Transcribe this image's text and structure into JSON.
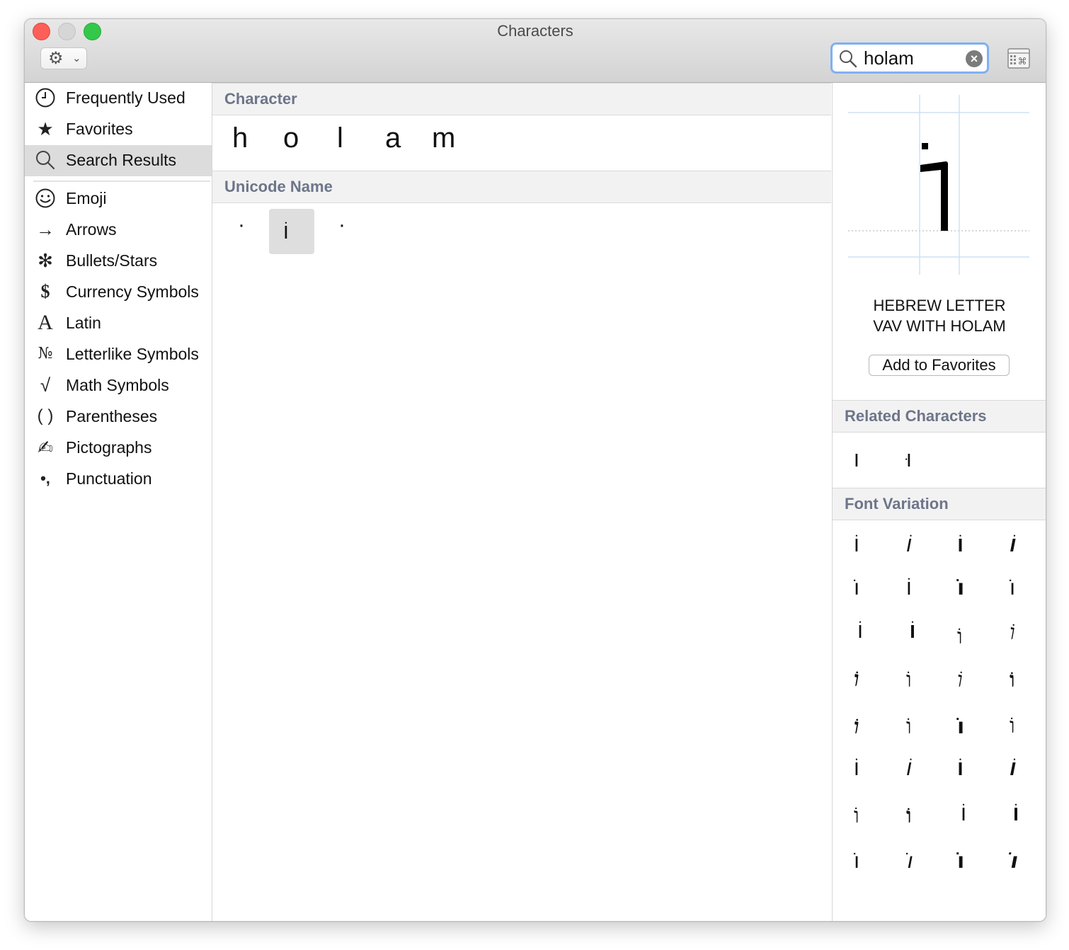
{
  "window": {
    "title": "Characters"
  },
  "search": {
    "value": "holam"
  },
  "sidebar": {
    "items": [
      {
        "label": "Frequently Used",
        "icon": "clock-icon",
        "glyph": "◷"
      },
      {
        "label": "Favorites",
        "icon": "star-icon",
        "glyph": "★"
      },
      {
        "label": "Search Results",
        "icon": "magnifier-icon",
        "glyph": "⌕"
      },
      {
        "label": "Emoji",
        "icon": "smiley-icon",
        "glyph": "☺"
      },
      {
        "label": "Arrows",
        "icon": "arrow-icon",
        "glyph": "→"
      },
      {
        "label": "Bullets/Stars",
        "icon": "asterisk-icon",
        "glyph": "✻"
      },
      {
        "label": "Currency Symbols",
        "icon": "dollar-icon",
        "glyph": "$"
      },
      {
        "label": "Latin",
        "icon": "latin-a-icon",
        "glyph": "A"
      },
      {
        "label": "Letterlike Symbols",
        "icon": "numero-icon",
        "glyph": "№"
      },
      {
        "label": "Math Symbols",
        "icon": "sqrt-icon",
        "glyph": "√"
      },
      {
        "label": "Parentheses",
        "icon": "parentheses-icon",
        "glyph": "( )"
      },
      {
        "label": "Pictographs",
        "icon": "writing-hand-icon",
        "glyph": "✍"
      },
      {
        "label": "Punctuation",
        "icon": "punctuation-icon",
        "glyph": "•,"
      }
    ],
    "selected_index": 2
  },
  "main": {
    "character_header": "Character",
    "letters": [
      "h",
      "o",
      "l",
      "a",
      "m"
    ],
    "unicode_header": "Unicode Name",
    "results": [
      "·",
      "וֹ",
      "·"
    ]
  },
  "detail": {
    "glyph": "וֹ",
    "name_line1": "HEBREW LETTER",
    "name_line2": "VAV WITH HOLAM",
    "add_favorites": "Add to Favorites",
    "related_header": "Related Characters",
    "related": [
      "ו",
      "וּ"
    ],
    "font_variation_header": "Font Variation",
    "variations": [
      "וֹ",
      "וֹ",
      "וֹ",
      "וֹ",
      "וֹ",
      "וֹ",
      "וֹ",
      "וֹ",
      "וֹ",
      "וֹ",
      "וֹ",
      "וֹ",
      "וֹ",
      "וֹ",
      "וֹ",
      "וֹ",
      "וֹ",
      "וֹ",
      "וֹ",
      "וֹ",
      "וֹ",
      "וֹ",
      "וֹ",
      "וֹ",
      "וֹ",
      "וֹ",
      "וֹ",
      "וֹ",
      "וֹ",
      "וֹ",
      "וֹ",
      "וֹ"
    ]
  },
  "colors": {
    "section_header_text": "#6d7589",
    "selected_row": "#dcdcdc",
    "search_focus": "#7fb0f2"
  }
}
